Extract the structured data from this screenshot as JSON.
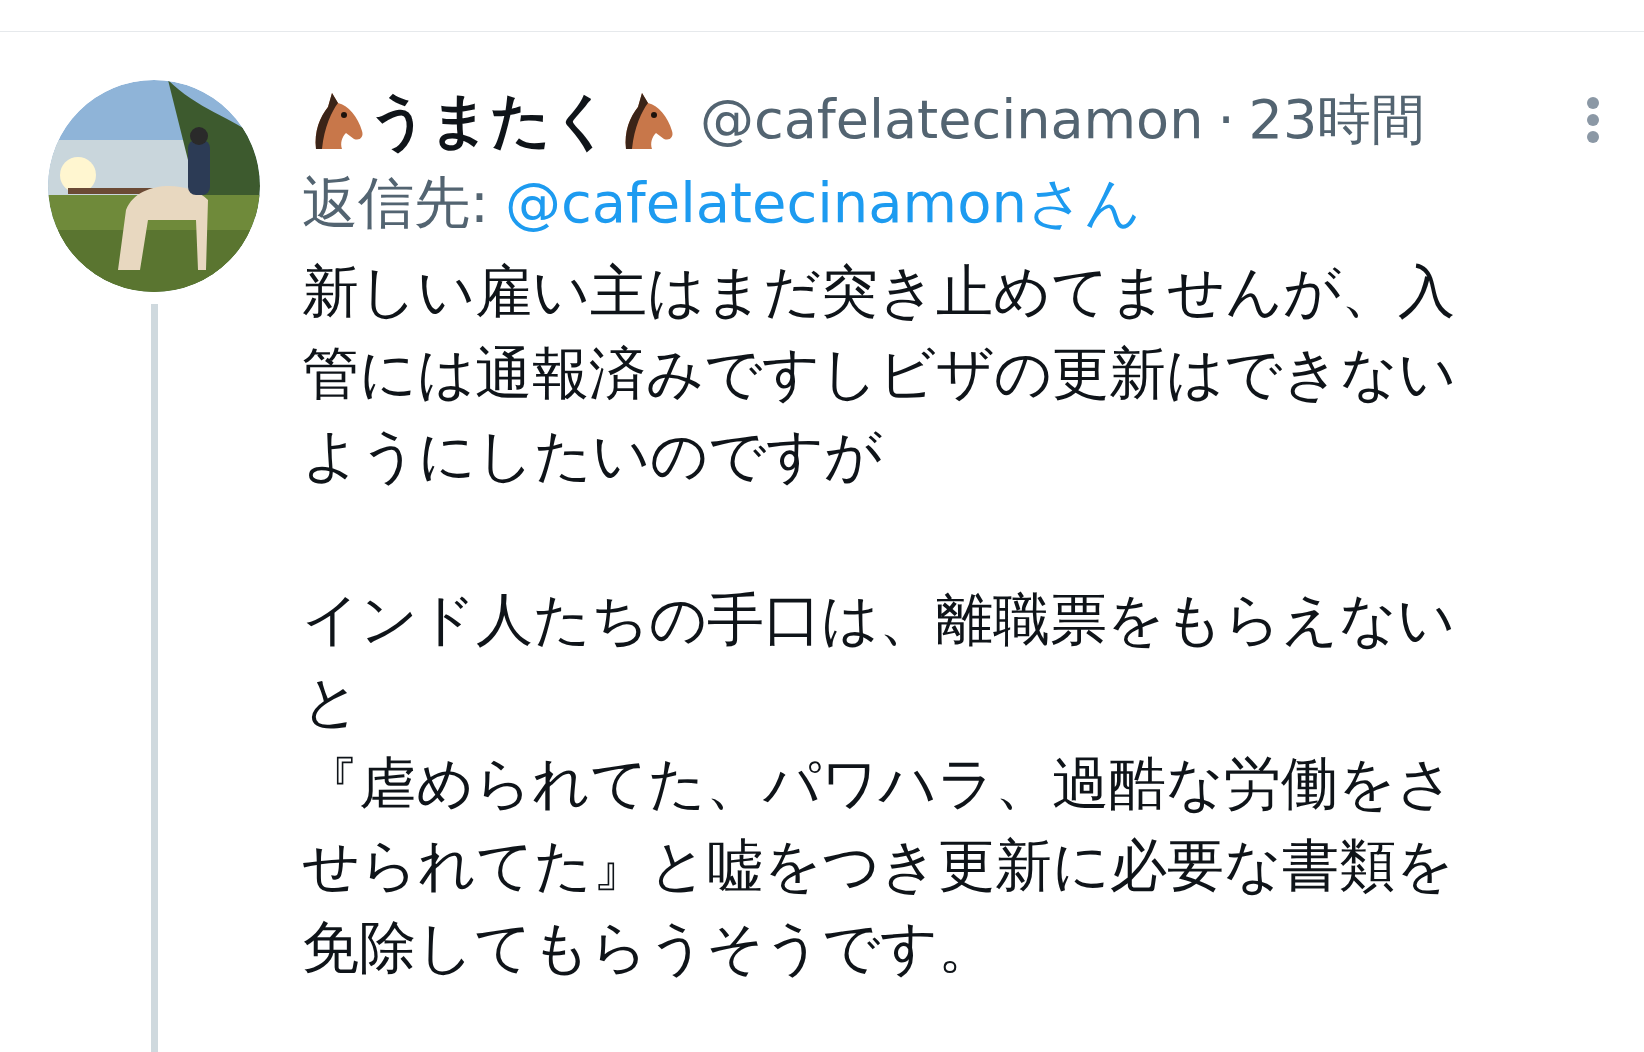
{
  "tweet": {
    "display_name": "うまたく",
    "handle": "@cafelatecinamon",
    "separator": "·",
    "time": "23時間",
    "reply_label": "返信先:",
    "reply_to": "@cafelatecinamonさん",
    "paragraphs": [
      [
        "新しい雇い主はまだ突き止めてませんが、入",
        "管には通報済みですしビザの更新はできない",
        "ようにしたいのですが"
      ],
      [
        "インド人たちの手口は、離職票をもらえない",
        "と",
        "『虐められてた、パワハラ、過酷な労働をさ",
        "せられてた』と嘘をつき更新に必要な書類を",
        "免除してもらうそうです。"
      ]
    ]
  }
}
